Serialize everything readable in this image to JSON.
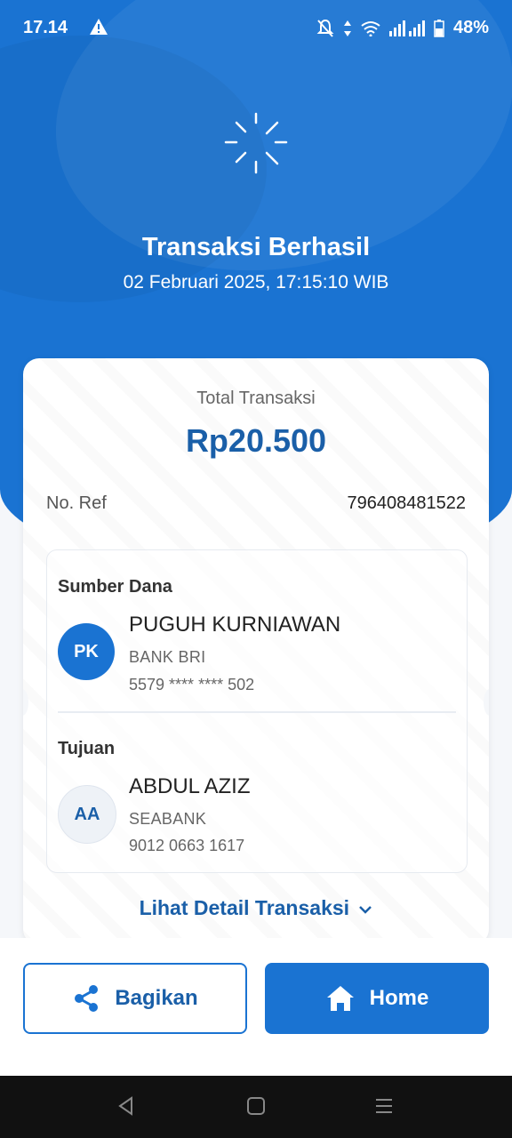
{
  "status_bar": {
    "time": "17.14",
    "battery": "48%",
    "icons": [
      "warning-icon",
      "mute-icon",
      "data-icon",
      "wifi-icon",
      "signal-icon",
      "battery-icon"
    ]
  },
  "header": {
    "title": "Transaksi Berhasil",
    "datetime": "02 Februari 2025, 17:15:10 WIB"
  },
  "summary": {
    "total_label": "Total Transaksi",
    "total_amount": "Rp20.500",
    "ref_label": "No. Ref",
    "ref_value": "796408481522"
  },
  "source": {
    "section_title": "Sumber Dana",
    "initials": "PK",
    "name": "PUGUH KURNIAWAN",
    "bank": "BANK BRI",
    "account": "5579 **** **** 502"
  },
  "destination": {
    "section_title": "Tujuan",
    "initials": "AA",
    "name": "ABDUL AZIZ",
    "bank": "SEABANK",
    "account": "9012 0663 1617"
  },
  "detail_link": "Lihat Detail Transaksi",
  "actions": {
    "share_label": "Bagikan",
    "home_label": "Home"
  },
  "colors": {
    "primary": "#1a73d2",
    "primary_text": "#1a5fa8"
  }
}
